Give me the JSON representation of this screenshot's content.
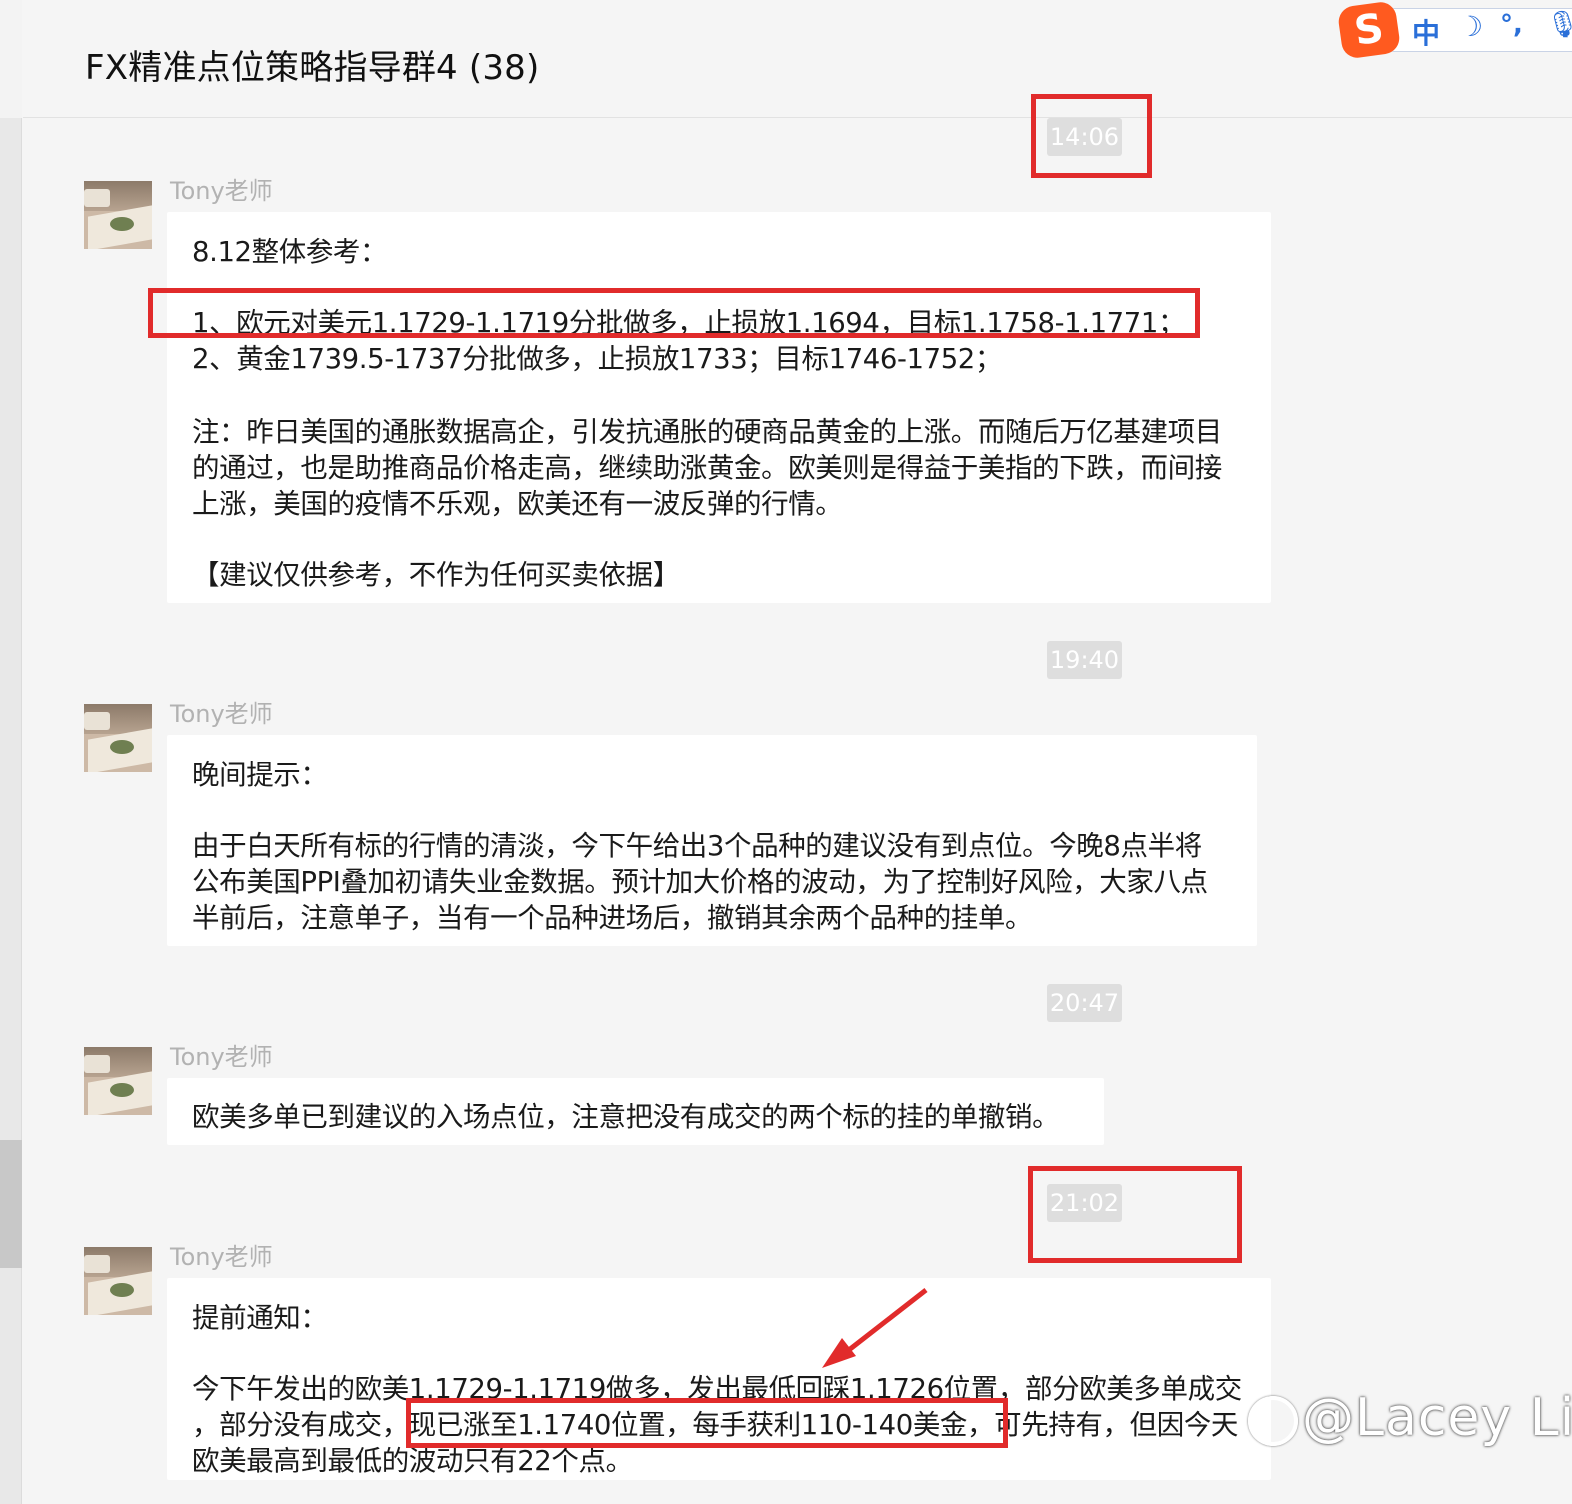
{
  "chat": {
    "title": "FX精准点位策略指导群4 (38)"
  },
  "ime": {
    "logo": "S",
    "mode": "中",
    "moon": "☽",
    "punct": "°,",
    "mic": "🎙"
  },
  "messages": [
    {
      "time": "14:06",
      "sender": "Tony老师",
      "lines": [
        "8.12整体参考：",
        "1、欧元对美元1.1729-1.1719分批做多，止损放1.1694，目标1.1758-1.1771；",
        "2、黄金1739.5-1737分批做多，止损放1733；目标1746-1752；",
        "注：昨日美国的通胀数据高企，引发抗通胀的硬商品黄金的上涨。而随后万亿基建项目",
        "的通过，也是助推商品价格走高，继续助涨黄金。欧美则是得益于美指的下跌，而间接",
        "上涨，美国的疫情不乐观，欧美还有一波反弹的行情。",
        "【建议仅供参考，不作为任何买卖依据】"
      ]
    },
    {
      "time": "19:40",
      "sender": "Tony老师",
      "lines": [
        "晚间提示：",
        "由于白天所有标的行情的清淡，今下午给出3个品种的建议没有到点位。今晚8点半将",
        "公布美国PPI叠加初请失业金数据。预计加大价格的波动，为了控制好风险，大家八点",
        "半前后，注意单子，当有一个品种进场后，撤销其余两个品种的挂单。"
      ]
    },
    {
      "time": "20:47",
      "sender": "Tony老师",
      "lines": [
        "欧美多单已到建议的入场点位，注意把没有成交的两个标的挂的单撤销。"
      ]
    },
    {
      "time": "21:02",
      "sender": "Tony老师",
      "lines": [
        "提前通知：",
        "今下午发出的欧美1.1729-1.1719做多，发出最低回踩1.1726位置，部分欧美多单成交",
        "，部分没有成交，现已涨至1.1740位置，每手获利110-140美金，可先持有，但因今天",
        "欧美最高到最低的波动只有22个点。"
      ]
    }
  ],
  "watermark": {
    "text": "@Lacey Li"
  },
  "colors": {
    "highlight": "#e12b2b",
    "background": "#f5f5f5",
    "bubble": "#ffffff",
    "timestamp_bg": "#dedede"
  }
}
